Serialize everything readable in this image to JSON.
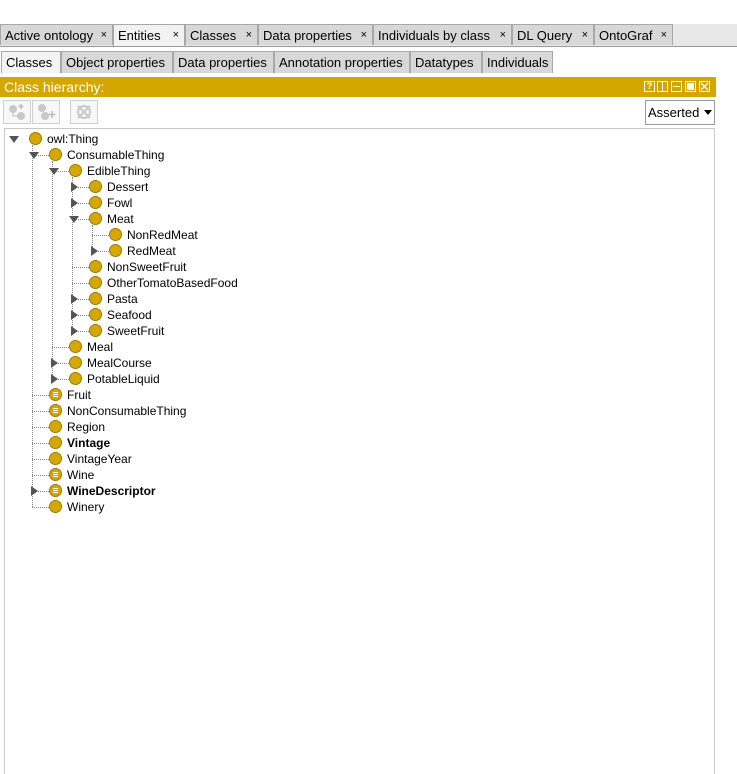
{
  "workspace_tabs": [
    {
      "label": "Active ontology",
      "close": "×"
    },
    {
      "label": "Entities",
      "close": "×",
      "active": true
    },
    {
      "label": "Classes",
      "close": "×"
    },
    {
      "label": "Data properties",
      "close": "×"
    },
    {
      "label": "Individuals by class",
      "close": "×"
    },
    {
      "label": "DL Query",
      "close": "×"
    },
    {
      "label": "OntoGraf",
      "close": "×"
    }
  ],
  "entity_tabs": [
    {
      "label": "Classes",
      "active": true
    },
    {
      "label": "Object properties"
    },
    {
      "label": "Data properties"
    },
    {
      "label": "Annotation properties"
    },
    {
      "label": "Datatypes"
    },
    {
      "label": "Individuals"
    }
  ],
  "panel": {
    "title": "Class hierarchy:",
    "window_buttons": [
      "help",
      "split",
      "minimize",
      "maximize",
      "close"
    ],
    "help_glyph": "?"
  },
  "toolbar": {
    "buttons": [
      "add-subclass-icon",
      "add-sibling-icon",
      "delete-class-icon"
    ],
    "view_mode": "Asserted"
  },
  "tree": {
    "nodes": [
      {
        "label": "owl:Thing",
        "level": 0,
        "toggle": "expanded",
        "icon": "class"
      },
      {
        "label": "ConsumableThing",
        "level": 1,
        "toggle": "expanded",
        "icon": "class"
      },
      {
        "label": "EdibleThing",
        "level": 2,
        "toggle": "expanded",
        "icon": "class"
      },
      {
        "label": "Dessert",
        "level": 3,
        "toggle": "collapsed",
        "icon": "class"
      },
      {
        "label": "Fowl",
        "level": 3,
        "toggle": "collapsed",
        "icon": "class"
      },
      {
        "label": "Meat",
        "level": 3,
        "toggle": "expanded",
        "icon": "class"
      },
      {
        "label": "NonRedMeat",
        "level": 4,
        "toggle": "none",
        "icon": "class"
      },
      {
        "label": "RedMeat",
        "level": 4,
        "toggle": "collapsed",
        "icon": "class"
      },
      {
        "label": "NonSweetFruit",
        "level": 3,
        "toggle": "none",
        "icon": "class"
      },
      {
        "label": "OtherTomatoBasedFood",
        "level": 3,
        "toggle": "none",
        "icon": "class"
      },
      {
        "label": "Pasta",
        "level": 3,
        "toggle": "collapsed",
        "icon": "class"
      },
      {
        "label": "Seafood",
        "level": 3,
        "toggle": "collapsed",
        "icon": "class"
      },
      {
        "label": "SweetFruit",
        "level": 3,
        "toggle": "collapsed",
        "icon": "class"
      },
      {
        "label": "Meal",
        "level": 2,
        "toggle": "none",
        "icon": "class"
      },
      {
        "label": "MealCourse",
        "level": 2,
        "toggle": "collapsed",
        "icon": "class"
      },
      {
        "label": "PotableLiquid",
        "level": 2,
        "toggle": "collapsed",
        "icon": "class"
      },
      {
        "label": "Fruit",
        "level": 1,
        "toggle": "none",
        "icon": "defined-class"
      },
      {
        "label": "NonConsumableThing",
        "level": 1,
        "toggle": "none",
        "icon": "defined-class"
      },
      {
        "label": "Region",
        "level": 1,
        "toggle": "none",
        "icon": "class"
      },
      {
        "label": "Vintage",
        "level": 1,
        "toggle": "none",
        "icon": "class",
        "bold": true
      },
      {
        "label": "VintageYear",
        "level": 1,
        "toggle": "none",
        "icon": "class"
      },
      {
        "label": "Wine",
        "level": 1,
        "toggle": "none",
        "icon": "defined-class"
      },
      {
        "label": "WineDescriptor",
        "level": 1,
        "toggle": "collapsed",
        "icon": "defined-class",
        "bold": true
      },
      {
        "label": "Winery",
        "level": 1,
        "toggle": "none",
        "icon": "class"
      }
    ]
  },
  "colors": {
    "accent": "#d4a700",
    "class_icon": "#d4a800"
  }
}
